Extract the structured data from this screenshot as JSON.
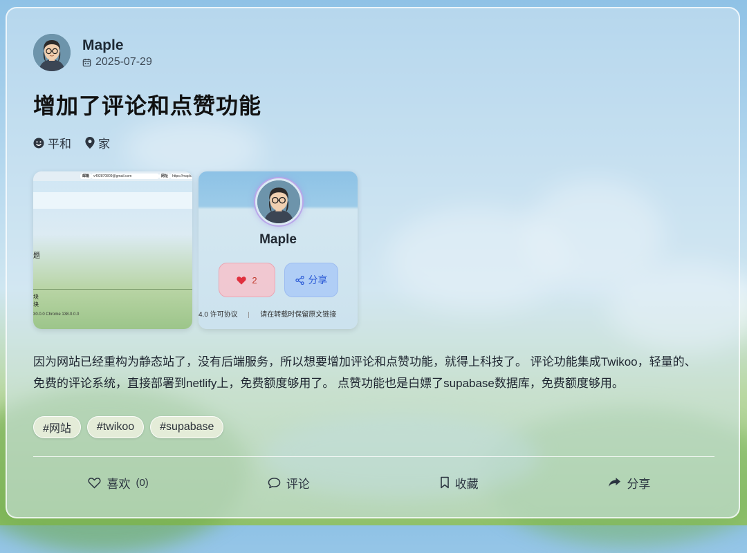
{
  "post": {
    "author": "Maple",
    "date": "2025-07-29",
    "title": "增加了评论和点赞功能",
    "mood": "平和",
    "location": "家",
    "content": "因为网站已经重构为静态站了，没有后端服务，所以想要增加评论和点赞功能，就得上科技了。 评论功能集成Twikoo，轻量的、免费的评论系统，直接部署到netlify上，免费额度够用了。 点赞功能也是白嫖了supabase数据库，免费额度够用。",
    "tags": [
      "#网站",
      "#twikoo",
      "#supabase"
    ]
  },
  "thumb1": {
    "email": "v492870809@gmail.com",
    "btn1": "邮箱",
    "btn2": "网址",
    "url": "https://maple",
    "frag1": "题",
    "frag2": "块",
    "frag3": "块",
    "footer": "30.0.0   Chrome 138.0.0.0"
  },
  "thumb2": {
    "name": "Maple",
    "like_count": "2",
    "share_label": "分享",
    "footer_license": "4.0 许可协议",
    "footer_notice": "请在转载时保留原文链接"
  },
  "actions": {
    "like_label": "喜欢",
    "like_count": "(0)",
    "comment_label": "评论",
    "favorite_label": "收藏",
    "share_label": "分享"
  },
  "colors": {
    "like_heart": "#e0303e",
    "share_blue": "#2c5bd6"
  }
}
